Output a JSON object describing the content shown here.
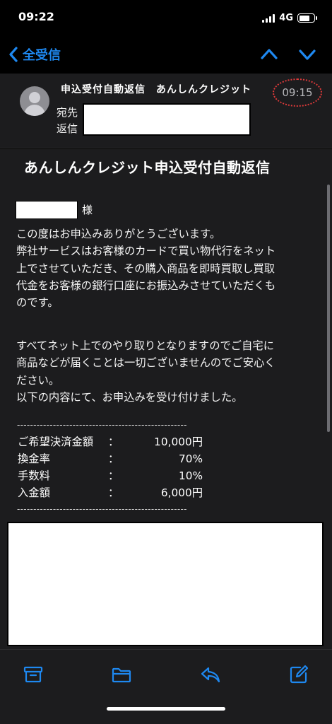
{
  "status_bar": {
    "time": "09:22",
    "network": "4G"
  },
  "nav": {
    "back_label": "全受信",
    "back_icon": "chevron-left-icon",
    "up_icon": "chevron-up-icon",
    "down_icon": "chevron-down-icon",
    "accent_color": "#1e88f0"
  },
  "header": {
    "subject": "申込受付自動返信　あんしんクレジット",
    "time": "09:15",
    "to_label": "宛先",
    "reply_label": "返信"
  },
  "body": {
    "title": "あんしんクレジット申込受付自動返信",
    "salutation_suffix": "様",
    "paragraph1": "この度はお申込みありがとうございます。\n弊社サービスはお客様のカードで買い物代行をネット\n上でさせていただき、その購入商品を即時買取し買取\n代金をお客様の銀行口座にお振込みさせていただくも\nのです。",
    "paragraph2": "すべてネット上でのやり取りとなりますのでご自宅に\n商品などが届くことは一切ございませんのでご安心く\nださい。\n以下の内容にて、お申込みを受け付けました。",
    "divider": "----------------------------------------------------",
    "fees": [
      {
        "label": "ご希望決済金額",
        "colon": "：",
        "value": "10,000円"
      },
      {
        "label": "換金率",
        "colon": "：",
        "value": "70%"
      },
      {
        "label": "手数料",
        "colon": "：",
        "value": "10%"
      },
      {
        "label": "入金額",
        "colon": "：",
        "value": "6,000円"
      }
    ]
  },
  "toolbar": {
    "icons": [
      "archive-icon",
      "folder-icon",
      "reply-icon",
      "compose-icon"
    ]
  }
}
